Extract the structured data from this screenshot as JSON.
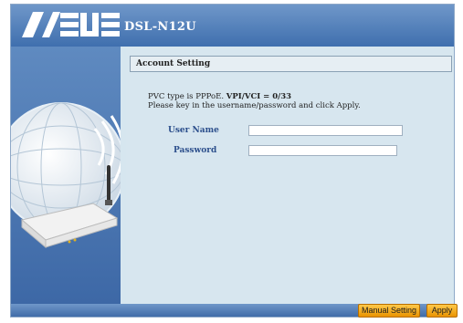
{
  "header": {
    "model": "DSL-N12U"
  },
  "section": {
    "title": "Account Setting"
  },
  "message": {
    "line1_prefix": "PVC type is PPPoE.",
    "line1_vpi": "VPI/VCI = 0/33",
    "line2": "Please key in the username/password and click Apply."
  },
  "form": {
    "username_label": "User Name",
    "username_value": "",
    "password_label": "Password",
    "password_value": ""
  },
  "buttons": {
    "manual_label": "Manual Setting",
    "apply_label": "Apply"
  },
  "colors": {
    "header_blue": "#3f6fae",
    "accent_orange": "#f0a000",
    "label_blue": "#2c4f8c"
  },
  "icons": [
    "asus-logo",
    "globe-illustration",
    "router-illustration"
  ]
}
